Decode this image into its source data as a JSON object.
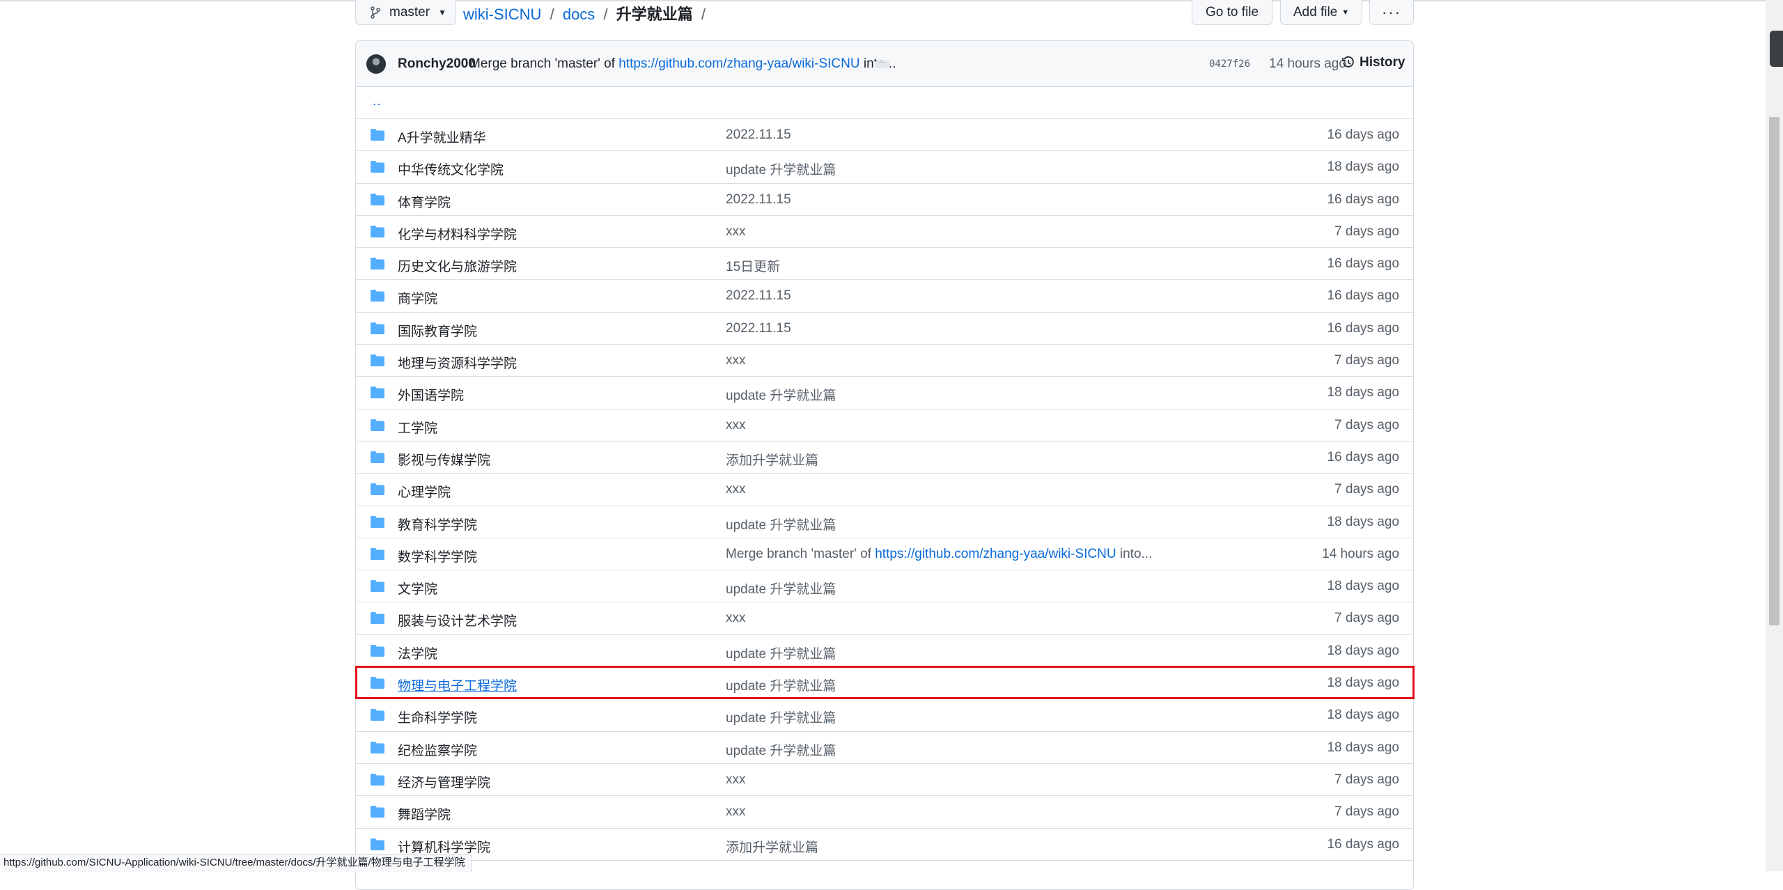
{
  "branch": {
    "name": "master"
  },
  "breadcrumb": {
    "repo": "wiki-SICNU",
    "sep1": "/",
    "dir": "docs",
    "sep2": "/",
    "current": "升学就业篇",
    "trail": "/"
  },
  "actions": {
    "go_to_file": "Go to file",
    "add_file": "Add file",
    "more": "···"
  },
  "commit": {
    "author": "Ronchy2000",
    "message_prefix": "Merge branch 'master' of ",
    "message_link": "https://github.com/zhang-yaa/wiki-SICNU",
    "message_suffix": " into...",
    "ellipsis": "···",
    "sha": "0427f26",
    "time": "14 hours ago",
    "history_label": "History"
  },
  "parent_dir": "..",
  "files": [
    {
      "name": "A升学就业精华",
      "message": "2022.11.15",
      "age": "16 days ago"
    },
    {
      "name": "中华传统文化学院",
      "message": "update 升学就业篇",
      "age": "18 days ago"
    },
    {
      "name": "体育学院",
      "message": "2022.11.15",
      "age": "16 days ago"
    },
    {
      "name": "化学与材料科学学院",
      "message": "xxx",
      "age": "7 days ago"
    },
    {
      "name": "历史文化与旅游学院",
      "message": "15日更新",
      "age": "16 days ago"
    },
    {
      "name": "商学院",
      "message": "2022.11.15",
      "age": "16 days ago"
    },
    {
      "name": "国际教育学院",
      "message": "2022.11.15",
      "age": "16 days ago"
    },
    {
      "name": "地理与资源科学学院",
      "message": "xxx",
      "age": "7 days ago"
    },
    {
      "name": "外国语学院",
      "message": "update 升学就业篇",
      "age": "18 days ago"
    },
    {
      "name": "工学院",
      "message": "xxx",
      "age": "7 days ago"
    },
    {
      "name": "影视与传媒学院",
      "message": "添加升学就业篇",
      "age": "16 days ago"
    },
    {
      "name": "心理学院",
      "message": "xxx",
      "age": "7 days ago"
    },
    {
      "name": "教育科学学院",
      "message": "update 升学就业篇",
      "age": "18 days ago"
    },
    {
      "name": "数学科学学院",
      "message": "Merge branch 'master' of ",
      "message_link": "https://github.com/zhang-yaa/wiki-SICNU",
      "message_suffix": " into...",
      "age": "14 hours ago"
    },
    {
      "name": "文学院",
      "message": "update 升学就业篇",
      "age": "18 days ago"
    },
    {
      "name": "服装与设计艺术学院",
      "message": "xxx",
      "age": "7 days ago"
    },
    {
      "name": "法学院",
      "message": "update 升学就业篇",
      "age": "18 days ago"
    },
    {
      "name": "物理与电子工程学院",
      "message": "update 升学就业篇",
      "age": "18 days ago",
      "highlight": true
    },
    {
      "name": "生命科学学院",
      "message": "update 升学就业篇",
      "age": "18 days ago"
    },
    {
      "name": "纪检监察学院",
      "message": "update 升学就业篇",
      "age": "18 days ago"
    },
    {
      "name": "经济与管理学院",
      "message": "xxx",
      "age": "7 days ago"
    },
    {
      "name": "舞蹈学院",
      "message": "xxx",
      "age": "7 days ago"
    },
    {
      "name": "计算机科学学院",
      "message": "添加升学就业篇",
      "age": "16 days ago"
    }
  ],
  "status_url": "https://github.com/SICNU-Application/wiki-SICNU/tree/master/docs/升学就业篇/物理与电子工程学院",
  "colors": {
    "link": "#0969da",
    "folder": "#54aeff",
    "highlight_border": "#e0101a",
    "muted": "#57606a"
  },
  "icons": {
    "branch": "git-branch-icon",
    "folder": "folder-icon",
    "history": "clock-history-icon"
  }
}
